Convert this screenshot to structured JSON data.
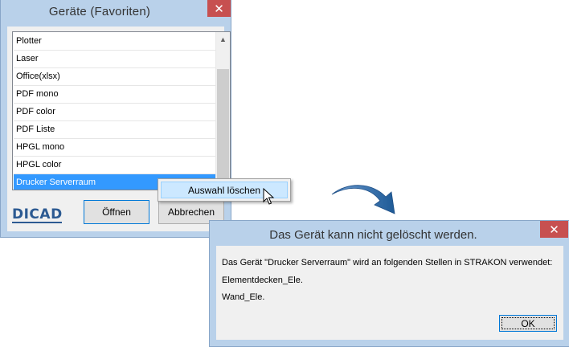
{
  "favorites_dialog": {
    "title": "Geräte (Favoriten)",
    "close_glyph": "✕",
    "list_items": [
      "Plotter",
      "Laser",
      "Office(xlsx)",
      "PDF mono",
      "PDF color",
      "PDF Liste",
      "HPGL mono",
      "HPGL color",
      "Drucker Serverraum"
    ],
    "selected_item": "Drucker Serverraum",
    "logo_text": "DICAD",
    "open_label": "Öffnen",
    "cancel_label": "Abbrechen",
    "scroll_up_glyph": "▲"
  },
  "context_menu": {
    "item_label": "Auswahl löschen"
  },
  "error_dialog": {
    "title": "Das Gerät kann nicht gelöscht werden.",
    "close_glyph": "✕",
    "message_line1": "Das Gerät \"Drucker Serverraum\" wird an folgenden Stellen in STRAKON verwendet:",
    "message_line2": "Elementdecken_Ele.",
    "message_line3": "Wand_Ele.",
    "ok_label": "OK"
  },
  "colors": {
    "window_frame": "#b9d1ea",
    "close_button": "#c75050",
    "selection": "#3399ff",
    "arrow": "#1e5a96"
  },
  "icons": {
    "close": "close-icon",
    "cursor": "mouse-pointer-icon",
    "arrow": "curved-arrow-icon"
  }
}
